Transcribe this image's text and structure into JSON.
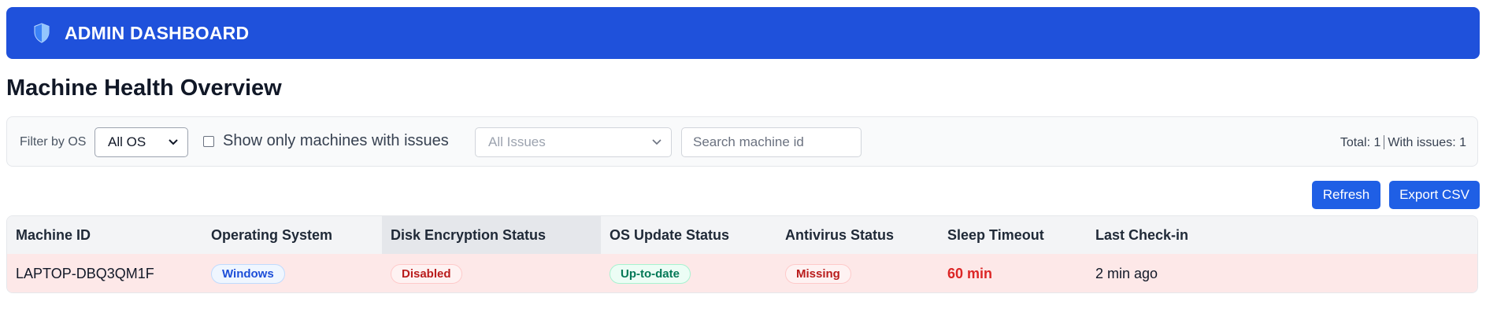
{
  "header": {
    "title": "ADMIN DASHBOARD",
    "icon": "shield-icon"
  },
  "page": {
    "title": "Machine Health Overview"
  },
  "filters": {
    "os_label": "Filter by OS",
    "os_selected": "All OS",
    "issues_checkbox_label": "Show only machines with issues",
    "issues_checked": false,
    "issues_selected": "All Issues",
    "search_placeholder": "Search machine id",
    "search_value": "",
    "total_text": "Total: 1",
    "with_issues_text": "With issues: 1"
  },
  "actions": {
    "refresh_label": "Refresh",
    "export_label": "Export CSV"
  },
  "table": {
    "columns": [
      "Machine ID",
      "Operating System",
      "Disk Encryption Status",
      "OS Update Status",
      "Antivirus Status",
      "Sleep Timeout",
      "Last Check-in"
    ],
    "sorted_column": "Disk Encryption Status",
    "rows": [
      {
        "machine_id": "LAPTOP-DBQ3QM1F",
        "os": "Windows",
        "disk_encryption": "Disabled",
        "os_update": "Up-to-date",
        "antivirus": "Missing",
        "sleep_timeout": "60 min",
        "last_checkin": "2 min ago",
        "has_issue": true
      }
    ]
  },
  "colors": {
    "brand": "#1f51db",
    "button": "#1f5fe5",
    "issue_row": "#fde8e8",
    "danger": "#dc2626",
    "success": "#047857"
  }
}
